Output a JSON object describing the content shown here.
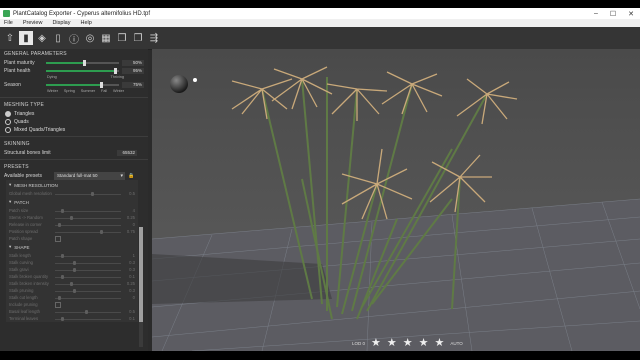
{
  "window": {
    "title": "PlantCatalog Exporter - Cyperus alternifolius HD.tpf",
    "minimize": "–",
    "maximize": "☐",
    "close": "✕"
  },
  "menu": [
    "File",
    "Preview",
    "Display",
    "Help"
  ],
  "toolbar": [
    "home-icon",
    "leaf-icon",
    "cube-icon",
    "stem-icon",
    "info-icon",
    "target-icon",
    "grid-icon",
    "cubes-icon",
    "cubes-alt-icon",
    "share-icon"
  ],
  "general": {
    "title": "GENERAL PARAMETERS",
    "maturity": {
      "label": "Plant maturity",
      "value": "50%",
      "fraction": 0.5
    },
    "health": {
      "label": "Plant health",
      "value": "95%",
      "fraction": 0.95,
      "ticks": [
        "Dying",
        "Thriving"
      ]
    },
    "season": {
      "label": "Season",
      "value": "75%",
      "fraction": 0.75,
      "ticks": [
        "Winter",
        "Spring",
        "Summer",
        "Fall",
        "Winter"
      ]
    }
  },
  "meshing": {
    "title": "MESHING TYPE",
    "options": [
      "Triangles",
      "Quads",
      "Mixed Quads/Triangles"
    ],
    "selected": 0
  },
  "skinning": {
    "title": "SKINNING",
    "label": "Structural bones limit",
    "value": "65532"
  },
  "presets": {
    "title": "PRESETS",
    "label": "Available presets",
    "selected": "Standard full-mat 50",
    "chev": "▾",
    "lock": "🔒"
  },
  "groups": {
    "mesh_resolution": {
      "title": "MESH RESOLUTION",
      "rows": [
        {
          "label": "Global mesh resolution",
          "value": "0.5",
          "knob": 0.6
        }
      ]
    },
    "patch": {
      "title": "PATCH",
      "rows": [
        {
          "label": "Patch size",
          "value": "4",
          "knob": 0.1
        },
        {
          "label": "Stems -> Random",
          "value": "0.25",
          "knob": 0.25
        },
        {
          "label": "Release in corner",
          "value": "0",
          "knob": 0.05
        },
        {
          "label": "Position spread",
          "value": "0.75",
          "knob": 0.75
        },
        {
          "label": "Patch shape",
          "value": "",
          "knob": -1
        }
      ]
    },
    "shape": {
      "title": "SHAPE",
      "rows": [
        {
          "label": "Stalk length",
          "value": "1",
          "knob": 0.1
        },
        {
          "label": "Stalk curving",
          "value": "0.3",
          "knob": 0.3
        },
        {
          "label": "Stalk gravi",
          "value": "0.3",
          "knob": 0.3
        },
        {
          "label": "Stalk broken quantity",
          "value": "0.1",
          "knob": 0.1
        },
        {
          "label": "Stalk broken intensity",
          "value": "0.25",
          "knob": 0.25
        },
        {
          "label": "Stalk pruning",
          "value": "0.3",
          "knob": 0.3
        },
        {
          "label": "Stalk cut length",
          "value": "0",
          "knob": 0.05
        },
        {
          "label": "Include pruning",
          "value": "",
          "knob": -1
        },
        {
          "label": "Basal leaf length",
          "value": "0.5",
          "knob": 0.5
        },
        {
          "label": "Terminal leaves",
          "value": "0.1",
          "knob": 0.1
        }
      ]
    }
  },
  "bottom": {
    "lod": "LOD 0",
    "stars": [
      "★",
      "★",
      "★",
      "★",
      "★"
    ],
    "auto": "AUTO"
  }
}
